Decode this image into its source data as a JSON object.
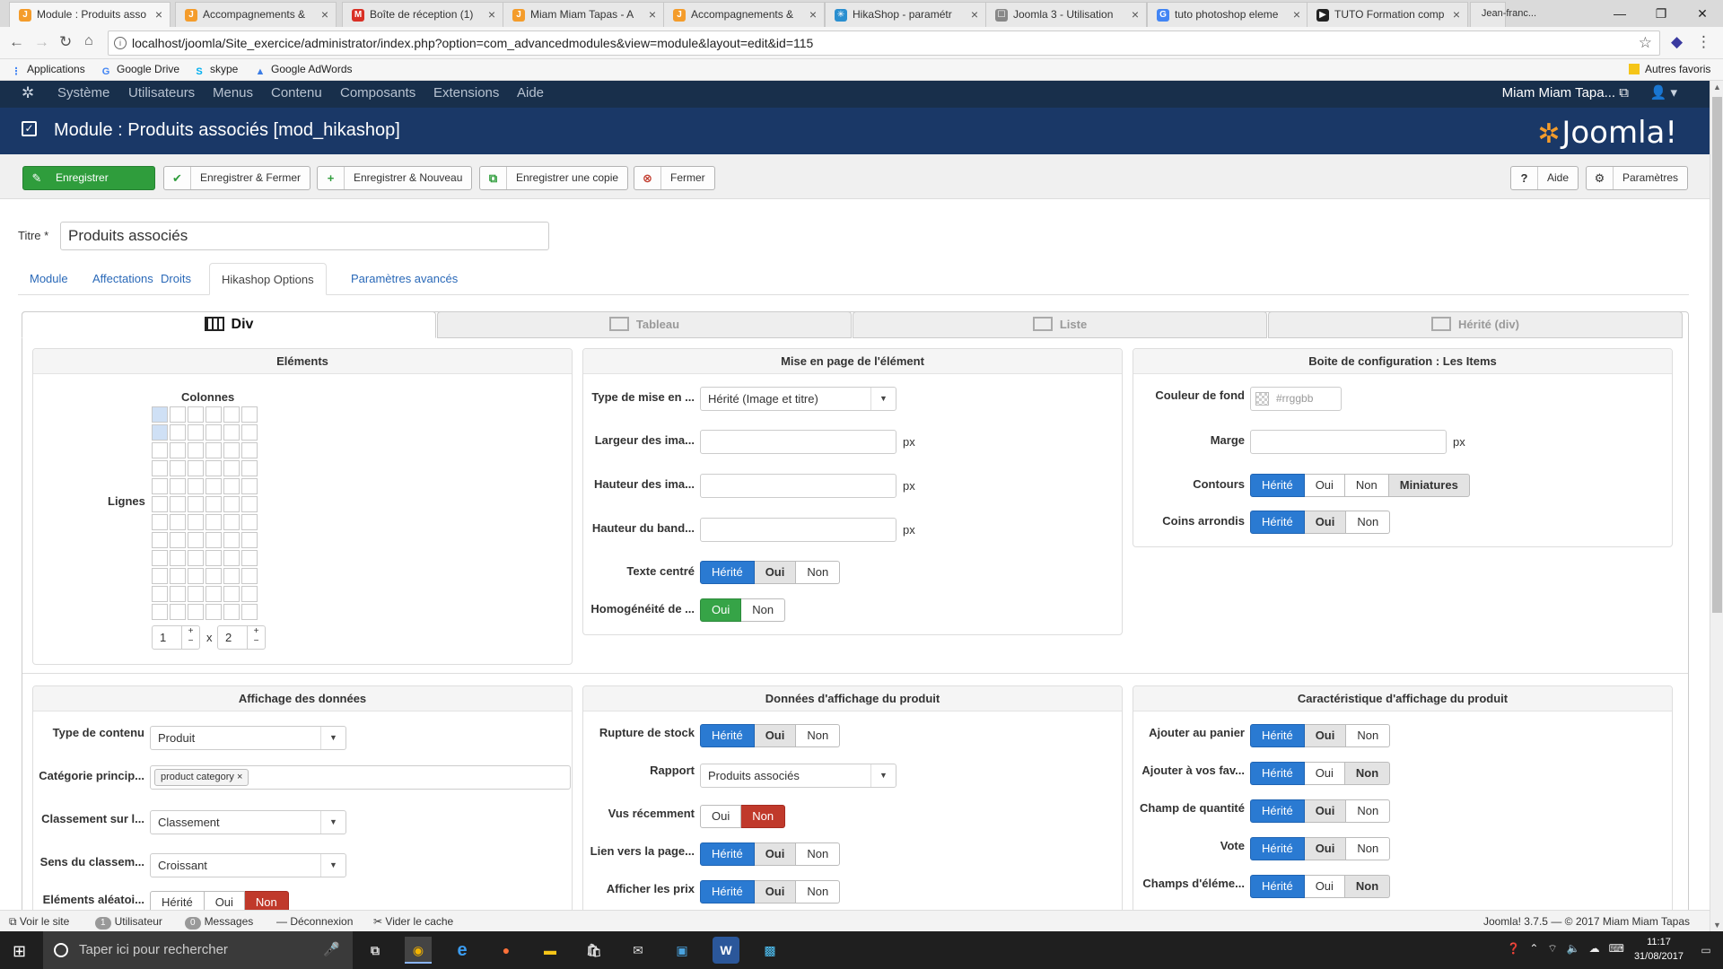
{
  "browser": {
    "tabs": [
      {
        "label": "Module : Produits asso",
        "color": "#f49c2b",
        "glyph": "J",
        "active": true
      },
      {
        "label": "Accompagnements &",
        "color": "#f49c2b",
        "glyph": "J"
      },
      {
        "label": "Boîte de réception (1)",
        "color": "#d93025",
        "glyph": "M"
      },
      {
        "label": "Miam Miam Tapas - A",
        "color": "#f49c2b",
        "glyph": "J"
      },
      {
        "label": "Accompagnements &",
        "color": "#f49c2b",
        "glyph": "J"
      },
      {
        "label": "HikaShop - paramétr",
        "color": "#2a8fd0",
        "glyph": "✳"
      },
      {
        "label": "Joomla 3 - Utilisation",
        "color": "#888",
        "glyph": "☐"
      },
      {
        "label": "tuto photoshop eleme",
        "color": "#4285f4",
        "glyph": "G"
      },
      {
        "label": "TUTO Formation comp",
        "color": "#222",
        "glyph": "▶"
      }
    ],
    "user_badge": "Jean-franc...",
    "url": "localhost/joomla/Site_exercice/administrator/index.php?option=com_advancedmodules&view=module&layout=edit&id=115",
    "bookmarks": [
      {
        "label": "Applications",
        "icon": "apps-icon",
        "glyph": "⋮",
        "color": "#4285f4"
      },
      {
        "label": "Google Drive",
        "icon": "google-icon",
        "glyph": "G",
        "color": "#4285f4"
      },
      {
        "label": "skype",
        "icon": "skype-icon",
        "glyph": "S",
        "color": "#00aff0"
      },
      {
        "label": "Google AdWords",
        "icon": "adwords-icon",
        "glyph": "▲",
        "color": "#3b7ce5"
      }
    ],
    "other_bookmarks": "Autres favoris"
  },
  "joomla": {
    "menu": [
      "Système",
      "Utilisateurs",
      "Menus",
      "Contenu",
      "Composants",
      "Extensions",
      "Aide"
    ],
    "site_name": "Miam Miam Tapa...",
    "page_title": "Module : Produits associés [mod_hikashop]",
    "brand": "Joomla!",
    "toolbar": {
      "save": "Enregistrer",
      "save_close": "Enregistrer & Fermer",
      "save_new": "Enregistrer & Nouveau",
      "save_copy": "Enregistrer une copie",
      "close": "Fermer",
      "help": "Aide",
      "options": "Paramètres"
    },
    "title_label": "Titre *",
    "title_value": "Produits associés",
    "tabs": [
      "Module",
      "Affectations",
      "Droits",
      "Hikashop Options",
      "Paramètres avancés"
    ],
    "active_tab": "Hikashop Options"
  },
  "hikashop": {
    "layout_tabs": [
      "Div",
      "Tableau",
      "Liste",
      "Hérité (div)"
    ],
    "elements": {
      "legend": "Eléments",
      "columns_label": "Colonnes",
      "rows_label": "Lignes",
      "rows_value": "1",
      "cols_value": "2",
      "times": "x"
    },
    "item_layout": {
      "legend": "Mise en page de l'élément",
      "type_label": "Type de mise en ...",
      "type_value": "Hérité (Image et titre)",
      "width_label": "Largeur des ima...",
      "height_label": "Hauteur des ima...",
      "band_label": "Hauteur du band...",
      "unit": "px",
      "center_label": "Texte centré",
      "homog_label": "Homogénéité de ..."
    },
    "items_box": {
      "legend": "Boite de configuration : Les Items",
      "bg_label": "Couleur de fond",
      "bg_placeholder": "#rrggbb",
      "margin_label": "Marge",
      "unit": "px",
      "borders_label": "Contours",
      "rounded_label": "Coins arrondis"
    },
    "data_display": {
      "legend": "Affichage des données",
      "content_label": "Type de contenu",
      "content_value": "Produit",
      "category_label": "Catégorie princip...",
      "category_tag": "product category",
      "sort_label": "Classement sur l...",
      "sort_value": "Classement",
      "order_label": "Sens du classem...",
      "order_value": "Croissant",
      "random_label": "Eléments aléatoi..."
    },
    "product_data": {
      "legend": "Données d'affichage du produit",
      "stock_label": "Rupture de stock",
      "report_label": "Rapport",
      "report_value": "Produits associés",
      "recent_label": "Vus récemment",
      "link_label": "Lien vers la page...",
      "prices_label": "Afficher les prix"
    },
    "product_features": {
      "legend": "Caractéristique d'affichage du produit",
      "cart_label": "Ajouter au panier",
      "fav_label": "Ajouter à vos fav...",
      "qty_label": "Champ de quantité",
      "vote_label": "Vote",
      "fields_label": "Champs d'éléme..."
    },
    "opts": {
      "inherit": "Hérité",
      "yes": "Oui",
      "no": "Non",
      "thumbs": "Miniatures"
    }
  },
  "statusbar": {
    "view_site": "Voir le site",
    "users_count": "1",
    "users": "Utilisateur",
    "messages_count": "0",
    "messages": "Messages",
    "logout": "Déconnexion",
    "cache": "Vider le cache",
    "version": "Joomla! 3.7.5 — © 2017 Miam Miam Tapas"
  },
  "taskbar": {
    "search_placeholder": "Taper ici pour rechercher",
    "time": "11:17",
    "date": "31/08/2017"
  }
}
